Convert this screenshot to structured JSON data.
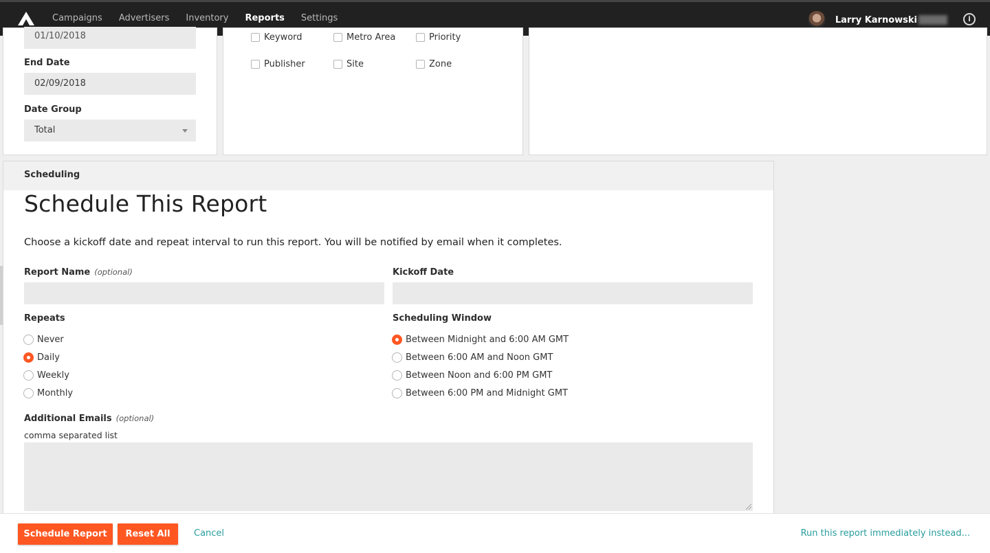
{
  "nav": {
    "items": [
      "Campaigns",
      "Advertisers",
      "Inventory",
      "Reports",
      "Settings"
    ],
    "active": "Reports",
    "user_name": "Larry Karnowski",
    "info_icon": "info-circle-icon"
  },
  "filters": {
    "start_date_value": "01/10/2018",
    "end_date_label": "End Date",
    "end_date_value": "02/09/2018",
    "date_group_label": "Date Group",
    "date_group_value": "Total"
  },
  "breakdowns": {
    "row1": [
      "Keyword",
      "Metro Area",
      "Priority"
    ],
    "row2": [
      "Publisher",
      "Site",
      "Zone"
    ]
  },
  "scheduling": {
    "section_title": "Scheduling",
    "heading": "Schedule This Report",
    "description": "Choose a kickoff date and repeat interval to run this report. You will be notified by email when it completes.",
    "report_name_label": "Report Name",
    "optional": "(optional)",
    "kickoff_date_label": "Kickoff Date",
    "repeats_label": "Repeats",
    "repeats_options": [
      "Never",
      "Daily",
      "Weekly",
      "Monthly"
    ],
    "repeats_selected": "Daily",
    "window_label": "Scheduling Window",
    "window_options": [
      "Between Midnight and 6:00 AM GMT",
      "Between 6:00 AM and Noon GMT",
      "Between Noon and 6:00 PM GMT",
      "Between 6:00 PM and Midnight GMT"
    ],
    "window_selected": "Between Midnight and 6:00 AM GMT",
    "emails_label": "Additional Emails",
    "emails_helper": "comma separated list"
  },
  "footer": {
    "schedule_button": "Schedule Report",
    "reset_button": "Reset All",
    "cancel_link": "Cancel",
    "run_now_link": "Run this report immediately instead..."
  },
  "colors": {
    "accent": "#ff5722",
    "link": "#2a9d9d",
    "nav_bg": "#212121"
  }
}
